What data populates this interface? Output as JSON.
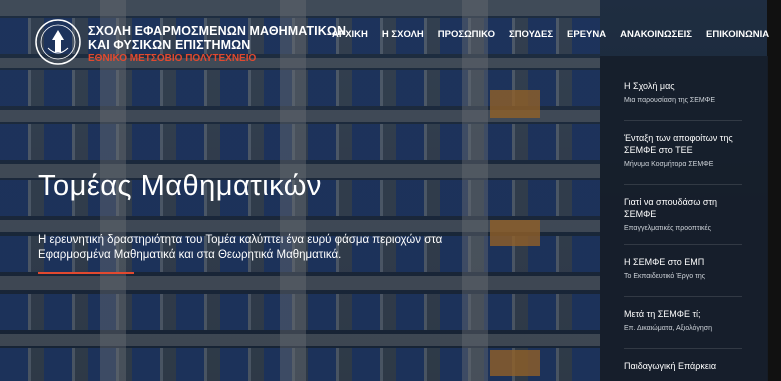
{
  "brand": {
    "line1": "ΣΧΟΛΗ ΕΦΑΡΜΟΣΜΕΝΩΝ ΜΑΘΗΜΑΤΙΚΩΝ",
    "line2": "ΚΑΙ ΦΥΣΙΚΩΝ ΕΠΙΣΤΗΜΩΝ",
    "line3": "ΕΘΝΙΚΟ ΜΕΤΣΟΒΙΟ ΠΟΛΥΤΕΧΝΕΙΟ"
  },
  "nav": [
    {
      "label": "ΑΡΧΙΚΗ"
    },
    {
      "label": "Η ΣΧΟΛΗ"
    },
    {
      "label": "ΠΡΟΣΩΠΙΚΟ"
    },
    {
      "label": "ΣΠΟΥΔΕΣ"
    },
    {
      "label": "ΕΡΕΥΝΑ"
    },
    {
      "label": "ΑΝΑΚΟΙΝΩΣΕΙΣ"
    },
    {
      "label": "ΕΠΙΚΟΙΝΩΝΙΑ"
    }
  ],
  "hero": {
    "title": "Τομέας Μαθηματικών",
    "description": "Η ερευνητική δραστηριότητα του Τομέα καλύπτει ένα ευρύ φάσμα περιοχών στα Εφαρμοσμένα Μαθηματικά και στα Θεωρητικά Μαθηματικά.",
    "accent_color": "#e2492f"
  },
  "side_menu": [
    {
      "title": "Η Σχολή μας",
      "subtitle": "Μια παρουσίαση της ΣΕΜΦΕ"
    },
    {
      "title": "Ένταξη των αποφοίτων της ΣΕΜΦΕ στο ΤΕΕ",
      "subtitle": "Μήνυμα Κοσμήτορα ΣΕΜΦΕ"
    },
    {
      "title": "Γιατί να σπουδάσω στη ΣΕΜΦΕ",
      "subtitle": "Επαγγελματικές προοπτικές"
    },
    {
      "title": "Η ΣΕΜΦΕ στο ΕΜΠ",
      "subtitle": "Το Εκπαιδευτικό Έργο της"
    },
    {
      "title": "Μετά τη ΣΕΜΦΕ τί;",
      "subtitle": "Επ. Δικαιώματα, Αξιολόγηση"
    },
    {
      "title": "Παιδαγωγική Επάρκεια",
      "subtitle": ""
    }
  ]
}
